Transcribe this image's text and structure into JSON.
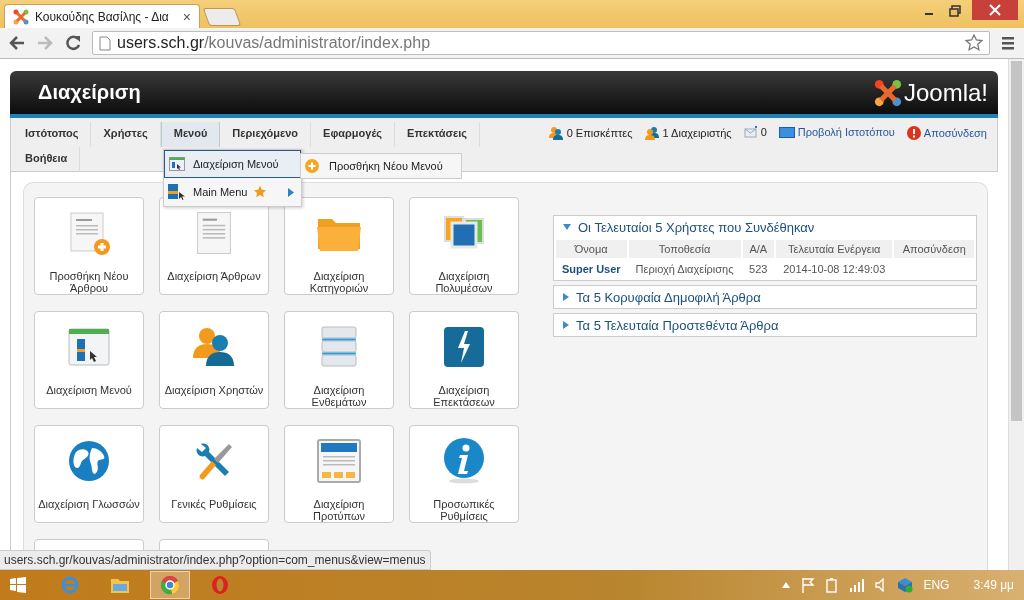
{
  "browser": {
    "tab_title": "Κουκούδης Βασίλης - Δια",
    "tab_close": "×",
    "url_host": "users.sch.gr",
    "url_path": "/kouvas/administrator/index.php"
  },
  "header": {
    "title": "Διαχείριση",
    "logo_text": "Joomla!"
  },
  "nav": {
    "items": [
      {
        "label": "Ιστότοπος",
        "selected": false
      },
      {
        "label": "Χρήστες",
        "selected": false
      },
      {
        "label": "Μενού",
        "selected": true
      },
      {
        "label": "Περιεχόμενο",
        "selected": false
      },
      {
        "label": "Εφαρμογές",
        "selected": false
      },
      {
        "label": "Επεκτάσεις",
        "selected": false
      },
      {
        "label": "Βοήθεια",
        "selected": false
      }
    ],
    "status": [
      {
        "kind": "visitors",
        "label": "0 Επισκέπτες"
      },
      {
        "kind": "admins",
        "label": "1 Διαχειριστής"
      },
      {
        "kind": "messages",
        "label": "0"
      },
      {
        "kind": "view_site",
        "label": "Προβολή Ιστοτόπου"
      },
      {
        "kind": "logout",
        "label": "Αποσύνδεση"
      }
    ]
  },
  "dropdown": {
    "items": [
      {
        "label": "Διαχείριση Μενού",
        "selected": true,
        "has_submenu": false
      },
      {
        "label": "Main Menu",
        "selected": false,
        "has_submenu": true
      }
    ],
    "submenu": {
      "label": "Προσθήκη Νέου Μενού"
    }
  },
  "tiles": [
    {
      "label": "Προσθήκη Νέου Άρθρου"
    },
    {
      "label": "Διαχείριση Άρθρων"
    },
    {
      "label": "Διαχείριση Κατηγοριών"
    },
    {
      "label": "Διαχείριση Πολυμέσων"
    },
    {
      "label": "Διαχείριση Μενού"
    },
    {
      "label": "Διαχείριση Χρηστών"
    },
    {
      "label": "Διαχείριση Ενθεμάτων"
    },
    {
      "label": "Διαχείριση Επεκτάσεων"
    },
    {
      "label": "Διαχείριση Γλωσσών"
    },
    {
      "label": "Γενικές Ρυθμίσεις"
    },
    {
      "label": "Διαχείριση Προτύπων"
    },
    {
      "label": "Προσωπικές Ρυθμίσεις"
    }
  ],
  "panels": [
    {
      "title": "Οι Τελευταίοι 5 Χρήστες που Συνδέθηκαν",
      "expanded": true,
      "table": {
        "columns": [
          "Όνομα",
          "Τοποθεσία",
          "Α/Α",
          "Τελευταία Ενέργεια",
          "Αποσύνδεση"
        ],
        "rows": [
          [
            "Super User",
            "Περιοχή Διαχείρισης",
            "523",
            "2014-10-08 12:49:03",
            ""
          ]
        ]
      }
    },
    {
      "title": "Τα 5 Κορυφαία Δημοφιλή Άρθρα",
      "expanded": false
    },
    {
      "title": "Τα 5 Τελευταία Προστεθέντα Άρθρα",
      "expanded": false
    }
  ],
  "status_url": "users.sch.gr/kouvas/administrator/index.php?option=com_menus&view=menus",
  "taskbar": {
    "language": "ENG",
    "time": "3:49 μμ"
  }
}
